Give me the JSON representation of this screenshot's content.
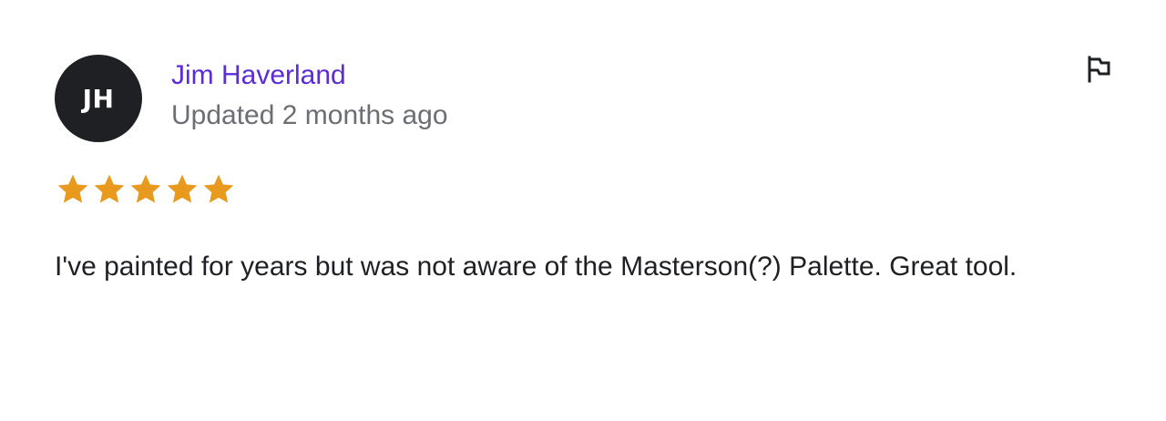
{
  "review": {
    "author": {
      "initials": "JH",
      "name": "Jim Haverland"
    },
    "timestamp": "Updated 2 months ago",
    "rating": {
      "value": 5,
      "max": 5,
      "star_color": "#e89a1e"
    },
    "text": "I've painted for years but was not aware of the Masterson(?) Palette. Great tool.",
    "flag_icon": "flag-icon"
  },
  "colors": {
    "author_link": "#5b2bd6",
    "avatar_bg": "#1f2023",
    "muted_text": "#6b6e73",
    "body_text": "#1f2023"
  }
}
